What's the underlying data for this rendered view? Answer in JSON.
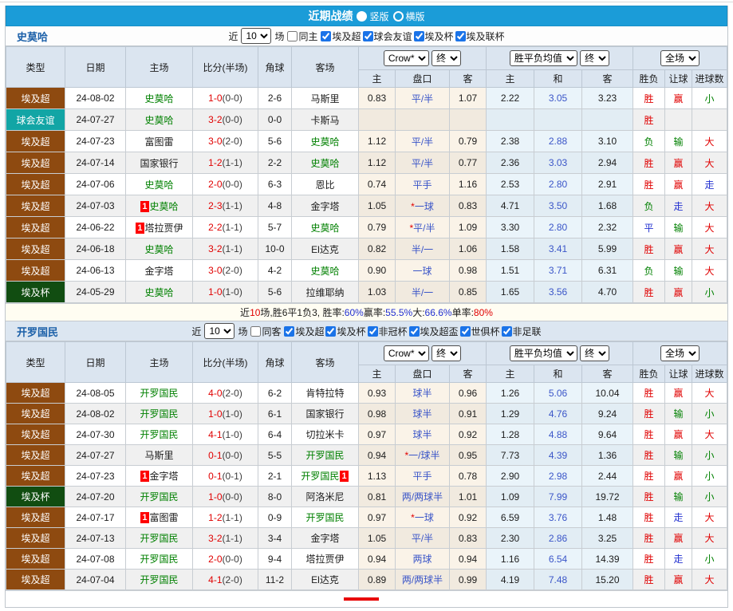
{
  "title": {
    "text": "近期战绩",
    "vertical": "竖版",
    "horizontal": "横版"
  },
  "table_header": {
    "type": "类型",
    "date": "日期",
    "home": "主场",
    "score": "比分(半场)",
    "corner": "角球",
    "away": "客场",
    "odds_source": "Crow*",
    "final": "终",
    "wdl_avg": "胜平负均值",
    "full": "全场",
    "ah_home": "主",
    "ah_line": "盘口",
    "ah_away": "客",
    "eu_home": "主",
    "eu_draw": "和",
    "eu_away": "客",
    "result_wdl": "胜负",
    "result_handicap": "让球",
    "result_goals": "进球数"
  },
  "sections": [
    {
      "team": "史莫哈",
      "near_label": "近",
      "count": "10",
      "matches_label": "场",
      "same_label": "同主",
      "leagues": [
        "埃及超",
        "球会友谊",
        "埃及杯",
        "埃及联杯"
      ],
      "rows": [
        {
          "league": "埃及超",
          "lg": "super",
          "date": "24-08-02",
          "home": {
            "name": "史莫哈",
            "g": 1
          },
          "score": "1-0",
          "half": "(0-0)",
          "corner": "2-6",
          "away": {
            "name": "马斯里"
          },
          "ah": [
            "0.83",
            "平/半",
            "1.07"
          ],
          "eu": [
            "2.22",
            "3.05",
            "3.23"
          ],
          "res": [
            [
              "胜",
              "r"
            ],
            [
              "赢",
              "r"
            ],
            [
              "小",
              "g"
            ]
          ]
        },
        {
          "league": "球会友谊",
          "lg": "friendly",
          "date": "24-07-27",
          "home": {
            "name": "史莫哈",
            "g": 1
          },
          "score": "3-2",
          "half": "(0-0)",
          "corner": "0-0",
          "away": {
            "name": "卡斯马"
          },
          "ah": null,
          "eu": null,
          "res": [
            [
              "胜",
              "r"
            ],
            null,
            null
          ]
        },
        {
          "league": "埃及超",
          "lg": "super",
          "date": "24-07-23",
          "home": {
            "name": "富图雷"
          },
          "score": "3-0",
          "half": "(2-0)",
          "corner": "5-6",
          "away": {
            "name": "史莫哈",
            "g": 1
          },
          "ah": [
            "1.12",
            "平/半",
            "0.79"
          ],
          "eu": [
            "2.38",
            "2.88",
            "3.10"
          ],
          "res": [
            [
              "负",
              "g"
            ],
            [
              "输",
              "g"
            ],
            [
              "大",
              "r"
            ]
          ]
        },
        {
          "league": "埃及超",
          "lg": "super",
          "date": "24-07-14",
          "home": {
            "name": "国家银行"
          },
          "score": "1-2",
          "half": "(1-1)",
          "corner": "2-2",
          "away": {
            "name": "史莫哈",
            "g": 1
          },
          "ah": [
            "1.12",
            "平/半",
            "0.77"
          ],
          "eu": [
            "2.36",
            "3.03",
            "2.94"
          ],
          "res": [
            [
              "胜",
              "r"
            ],
            [
              "赢",
              "r"
            ],
            [
              "大",
              "r"
            ]
          ]
        },
        {
          "league": "埃及超",
          "lg": "super",
          "date": "24-07-06",
          "home": {
            "name": "史莫哈",
            "g": 1
          },
          "score": "2-0",
          "half": "(0-0)",
          "corner": "6-3",
          "away": {
            "name": "恩比"
          },
          "ah": [
            "0.74",
            "平手",
            "1.16"
          ],
          "eu": [
            "2.53",
            "2.80",
            "2.91"
          ],
          "res": [
            [
              "胜",
              "r"
            ],
            [
              "赢",
              "r"
            ],
            [
              "走",
              "b"
            ]
          ]
        },
        {
          "league": "埃及超",
          "lg": "super",
          "date": "24-07-03",
          "home": {
            "name": "史莫哈",
            "g": 1,
            "badge": "1"
          },
          "score": "2-3",
          "half": "(1-1)",
          "corner": "4-8",
          "away": {
            "name": "金字塔"
          },
          "ah": [
            "1.05",
            "一球",
            "0.83"
          ],
          "star": 1,
          "eu": [
            "4.71",
            "3.50",
            "1.68"
          ],
          "res": [
            [
              "负",
              "g"
            ],
            [
              "走",
              "b"
            ],
            [
              "大",
              "r"
            ]
          ]
        },
        {
          "league": "埃及超",
          "lg": "super",
          "date": "24-06-22",
          "home": {
            "name": "塔拉贾伊",
            "badge": "1"
          },
          "score": "2-2",
          "half": "(1-1)",
          "corner": "5-7",
          "away": {
            "name": "史莫哈",
            "g": 1
          },
          "ah": [
            "0.79",
            "平/半",
            "1.09"
          ],
          "star": 1,
          "eu": [
            "3.30",
            "2.80",
            "2.32"
          ],
          "res": [
            [
              "平",
              "b"
            ],
            [
              "输",
              "g"
            ],
            [
              "大",
              "r"
            ]
          ]
        },
        {
          "league": "埃及超",
          "lg": "super",
          "date": "24-06-18",
          "home": {
            "name": "史莫哈",
            "g": 1
          },
          "score": "3-2",
          "half": "(1-1)",
          "corner": "10-0",
          "away": {
            "name": "El达克"
          },
          "ah": [
            "0.82",
            "半/一",
            "1.06"
          ],
          "eu": [
            "1.58",
            "3.41",
            "5.99"
          ],
          "res": [
            [
              "胜",
              "r"
            ],
            [
              "赢",
              "r"
            ],
            [
              "大",
              "r"
            ]
          ]
        },
        {
          "league": "埃及超",
          "lg": "super",
          "date": "24-06-13",
          "home": {
            "name": "金字塔"
          },
          "score": "3-0",
          "half": "(2-0)",
          "corner": "4-2",
          "away": {
            "name": "史莫哈",
            "g": 1
          },
          "ah": [
            "0.90",
            "一球",
            "0.98"
          ],
          "eu": [
            "1.51",
            "3.71",
            "6.31"
          ],
          "res": [
            [
              "负",
              "g"
            ],
            [
              "输",
              "g"
            ],
            [
              "大",
              "r"
            ]
          ]
        },
        {
          "league": "埃及杯",
          "lg": "cup",
          "date": "24-05-29",
          "home": {
            "name": "史莫哈",
            "g": 1
          },
          "score": "1-0",
          "half": "(1-0)",
          "corner": "5-6",
          "away": {
            "name": "拉维耶纳"
          },
          "ah": [
            "1.03",
            "半/一",
            "0.85"
          ],
          "eu": [
            "1.65",
            "3.56",
            "4.70"
          ],
          "res": [
            [
              "胜",
              "r"
            ],
            [
              "赢",
              "r"
            ],
            [
              "小",
              "g"
            ]
          ]
        }
      ],
      "summary": [
        {
          "t": "近",
          "c": "k"
        },
        {
          "t": "10",
          "c": "r"
        },
        {
          "t": "场,胜6平1负3, 胜率:",
          "c": "k"
        },
        {
          "t": "60%",
          "c": "b"
        },
        {
          "t": " 赢率:",
          "c": "k"
        },
        {
          "t": "55.5%",
          "c": "b"
        },
        {
          "t": " 大:",
          "c": "k"
        },
        {
          "t": "66.6%",
          "c": "b"
        },
        {
          "t": " 单率:",
          "c": "k"
        },
        {
          "t": "80%",
          "c": "r"
        }
      ]
    },
    {
      "team": "开罗国民",
      "near_label": "近",
      "count": "10",
      "matches_label": "场",
      "same_label": "同客",
      "leagues": [
        "埃及超",
        "埃及杯",
        "非冠杯",
        "埃及超盃",
        "世俱杯",
        "非足联"
      ],
      "rows": [
        {
          "league": "埃及超",
          "lg": "super",
          "date": "24-08-05",
          "home": {
            "name": "开罗国民",
            "g": 1
          },
          "score": "4-0",
          "half": "(2-0)",
          "corner": "6-2",
          "away": {
            "name": "肯特拉特"
          },
          "ah": [
            "0.93",
            "球半",
            "0.96"
          ],
          "eu": [
            "1.26",
            "5.06",
            "10.04"
          ],
          "res": [
            [
              "胜",
              "r"
            ],
            [
              "赢",
              "r"
            ],
            [
              "大",
              "r"
            ]
          ]
        },
        {
          "league": "埃及超",
          "lg": "super",
          "date": "24-08-02",
          "home": {
            "name": "开罗国民",
            "g": 1
          },
          "score": "1-0",
          "half": "(1-0)",
          "corner": "6-1",
          "away": {
            "name": "国家银行"
          },
          "ah": [
            "0.98",
            "球半",
            "0.91"
          ],
          "eu": [
            "1.29",
            "4.76",
            "9.24"
          ],
          "res": [
            [
              "胜",
              "r"
            ],
            [
              "输",
              "g"
            ],
            [
              "小",
              "g"
            ]
          ]
        },
        {
          "league": "埃及超",
          "lg": "super",
          "date": "24-07-30",
          "home": {
            "name": "开罗国民",
            "g": 1
          },
          "score": "4-1",
          "half": "(1-0)",
          "corner": "6-4",
          "away": {
            "name": "切拉米卡"
          },
          "ah": [
            "0.97",
            "球半",
            "0.92"
          ],
          "eu": [
            "1.28",
            "4.88",
            "9.64"
          ],
          "res": [
            [
              "胜",
              "r"
            ],
            [
              "赢",
              "r"
            ],
            [
              "大",
              "r"
            ]
          ]
        },
        {
          "league": "埃及超",
          "lg": "super",
          "date": "24-07-27",
          "home": {
            "name": "马斯里"
          },
          "score": "0-1",
          "half": "(0-0)",
          "corner": "5-5",
          "away": {
            "name": "开罗国民",
            "g": 1
          },
          "ah": [
            "0.94",
            "一/球半",
            "0.95"
          ],
          "star": 1,
          "eu": [
            "7.73",
            "4.39",
            "1.36"
          ],
          "res": [
            [
              "胜",
              "r"
            ],
            [
              "输",
              "g"
            ],
            [
              "小",
              "g"
            ]
          ]
        },
        {
          "league": "埃及超",
          "lg": "super",
          "date": "24-07-23",
          "home": {
            "name": "金字塔",
            "badge": "1"
          },
          "score": "0-1",
          "half": "(0-1)",
          "corner": "2-1",
          "away": {
            "name": "开罗国民",
            "g": 1,
            "badge": "1",
            "after": 1
          },
          "ah": [
            "1.13",
            "平手",
            "0.78"
          ],
          "eu": [
            "2.90",
            "2.98",
            "2.44"
          ],
          "res": [
            [
              "胜",
              "r"
            ],
            [
              "赢",
              "r"
            ],
            [
              "小",
              "g"
            ]
          ]
        },
        {
          "league": "埃及杯",
          "lg": "cup",
          "date": "24-07-20",
          "home": {
            "name": "开罗国民",
            "g": 1
          },
          "score": "1-0",
          "half": "(0-0)",
          "corner": "8-0",
          "away": {
            "name": "阿洛米尼"
          },
          "ah": [
            "0.81",
            "两/两球半",
            "1.01"
          ],
          "eu": [
            "1.09",
            "7.99",
            "19.72"
          ],
          "res": [
            [
              "胜",
              "r"
            ],
            [
              "输",
              "g"
            ],
            [
              "小",
              "g"
            ]
          ]
        },
        {
          "league": "埃及超",
          "lg": "super",
          "date": "24-07-17",
          "home": {
            "name": "富图雷",
            "badge": "1"
          },
          "score": "1-2",
          "half": "(1-1)",
          "corner": "0-9",
          "away": {
            "name": "开罗国民",
            "g": 1
          },
          "ah": [
            "0.97",
            "一球",
            "0.92"
          ],
          "star": 1,
          "eu": [
            "6.59",
            "3.76",
            "1.48"
          ],
          "res": [
            [
              "胜",
              "r"
            ],
            [
              "走",
              "b"
            ],
            [
              "大",
              "r"
            ]
          ]
        },
        {
          "league": "埃及超",
          "lg": "super",
          "date": "24-07-13",
          "home": {
            "name": "开罗国民",
            "g": 1
          },
          "score": "3-2",
          "half": "(1-1)",
          "corner": "3-4",
          "away": {
            "name": "金字塔"
          },
          "ah": [
            "1.05",
            "平/半",
            "0.83"
          ],
          "eu": [
            "2.30",
            "2.86",
            "3.25"
          ],
          "res": [
            [
              "胜",
              "r"
            ],
            [
              "赢",
              "r"
            ],
            [
              "大",
              "r"
            ]
          ]
        },
        {
          "league": "埃及超",
          "lg": "super",
          "date": "24-07-08",
          "home": {
            "name": "开罗国民",
            "g": 1
          },
          "score": "2-0",
          "half": "(0-0)",
          "corner": "9-4",
          "away": {
            "name": "塔拉贾伊"
          },
          "ah": [
            "0.94",
            "两球",
            "0.94"
          ],
          "eu": [
            "1.16",
            "6.54",
            "14.39"
          ],
          "res": [
            [
              "胜",
              "r"
            ],
            [
              "走",
              "b"
            ],
            [
              "小",
              "g"
            ]
          ]
        },
        {
          "league": "埃及超",
          "lg": "super",
          "date": "24-07-04",
          "home": {
            "name": "开罗国民",
            "g": 1
          },
          "score": "4-1",
          "half": "(2-0)",
          "corner": "11-2",
          "away": {
            "name": "El达克"
          },
          "ah": [
            "0.89",
            "两/两球半",
            "0.99"
          ],
          "eu": [
            "4.19",
            "7.48",
            "15.20"
          ],
          "res": [
            [
              "胜",
              "r"
            ],
            [
              "赢",
              "r"
            ],
            [
              "大",
              "r"
            ]
          ]
        }
      ],
      "summary": null
    }
  ]
}
